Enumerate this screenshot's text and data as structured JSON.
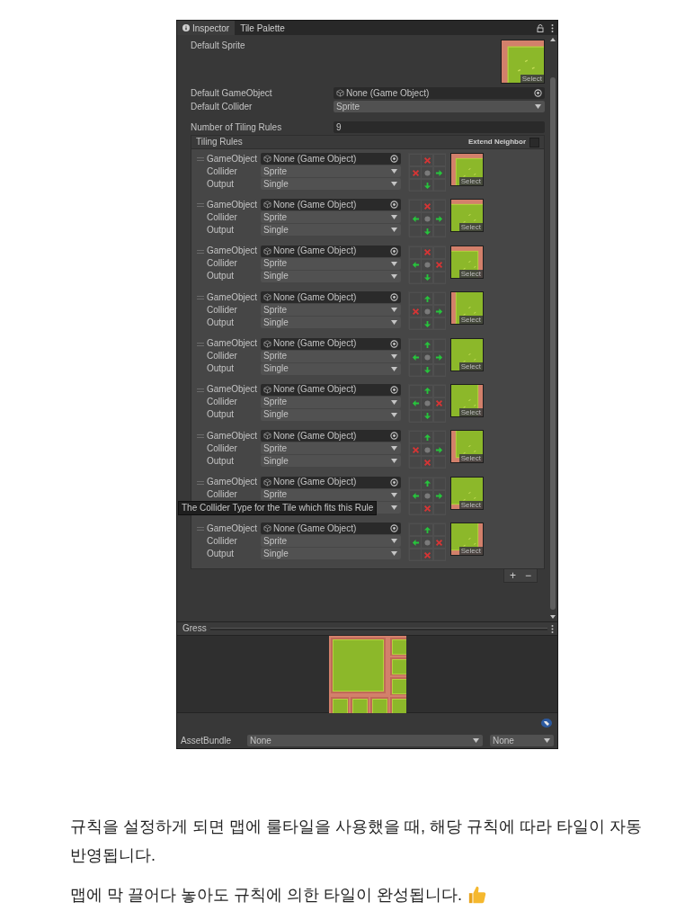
{
  "tabs": [
    {
      "label": "Inspector",
      "selected": true
    },
    {
      "label": "Tile Palette",
      "selected": false
    }
  ],
  "default_sprite": {
    "label": "Default Sprite",
    "select": "Select"
  },
  "fields": [
    {
      "label": "Default GameObject",
      "value": "None (Game Object)",
      "kind": "object"
    },
    {
      "label": "Default Collider",
      "value": "Sprite",
      "kind": "dropdown"
    },
    {
      "label": "Number of Tiling Rules",
      "value": "9",
      "kind": "number"
    }
  ],
  "tiling_rules": {
    "title": "Tiling Rules",
    "extend_neighbor": {
      "label": "Extend Neighbor",
      "checked": false
    },
    "add": "+",
    "remove": "−",
    "rules": [
      {
        "gameobject_label": "GameObject",
        "gameobject": "None (Game Object)",
        "collider_label": "Collider",
        "collider": "Sprite",
        "output_label": "Output",
        "output": "Single",
        "neighbors": {
          "top": {
            "kind": "not"
          },
          "left": {
            "kind": "not"
          },
          "right": {
            "kind": "this"
          },
          "bottom": {
            "kind": "this"
          }
        },
        "select": "Select"
      },
      {
        "gameobject_label": "GameObject",
        "gameobject": "None (Game Object)",
        "collider_label": "Collider",
        "collider": "Sprite",
        "output_label": "Output",
        "output": "Single",
        "neighbors": {
          "top": {
            "kind": "not"
          },
          "left": {
            "kind": "this"
          },
          "right": {
            "kind": "this"
          },
          "bottom": {
            "kind": "this"
          }
        },
        "select": "Select"
      },
      {
        "gameobject_label": "GameObject",
        "gameobject": "None (Game Object)",
        "collider_label": "Collider",
        "collider": "Sprite",
        "output_label": "Output",
        "output": "Single",
        "neighbors": {
          "top": {
            "kind": "not"
          },
          "left": {
            "kind": "this"
          },
          "right": {
            "kind": "not"
          },
          "bottom": {
            "kind": "this"
          }
        },
        "select": "Select"
      },
      {
        "gameobject_label": "GameObject",
        "gameobject": "None (Game Object)",
        "collider_label": "Collider",
        "collider": "Sprite",
        "output_label": "Output",
        "output": "Single",
        "neighbors": {
          "top": {
            "kind": "this"
          },
          "left": {
            "kind": "not"
          },
          "right": {
            "kind": "this"
          },
          "bottom": {
            "kind": "this"
          }
        },
        "select": "Select"
      },
      {
        "gameobject_label": "GameObject",
        "gameobject": "None (Game Object)",
        "collider_label": "Collider",
        "collider": "Sprite",
        "output_label": "Output",
        "output": "Single",
        "neighbors": {
          "top": {
            "kind": "this"
          },
          "left": {
            "kind": "this"
          },
          "right": {
            "kind": "this"
          },
          "bottom": {
            "kind": "this"
          }
        },
        "select": "Select"
      },
      {
        "gameobject_label": "GameObject",
        "gameobject": "None (Game Object)",
        "collider_label": "Collider",
        "collider": "Sprite",
        "output_label": "Output",
        "output": "Single",
        "neighbors": {
          "top": {
            "kind": "this"
          },
          "left": {
            "kind": "this"
          },
          "right": {
            "kind": "not"
          },
          "bottom": {
            "kind": "this"
          }
        },
        "select": "Select"
      },
      {
        "gameobject_label": "GameObject",
        "gameobject": "None (Game Object)",
        "collider_label": "Collider",
        "collider": "Sprite",
        "output_label": "Output",
        "output": "Single",
        "neighbors": {
          "top": {
            "kind": "this"
          },
          "left": {
            "kind": "not"
          },
          "right": {
            "kind": "this"
          },
          "bottom": {
            "kind": "not"
          }
        },
        "select": "Select"
      },
      {
        "gameobject_label": "GameObject",
        "gameobject": "None (Game Object)",
        "collider_label": "Collider",
        "collider": "Sprite",
        "neighbors": {
          "top": {
            "kind": "this"
          },
          "left": {
            "kind": "this"
          },
          "right": {
            "kind": "this"
          },
          "bottom": {
            "kind": "not"
          }
        },
        "select": "Select",
        "tooltip": "The Collider Type for the Tile which fits this Rule"
      },
      {
        "gameobject_label": "GameObject",
        "gameobject": "None (Game Object)",
        "collider_label": "Collider",
        "collider": "Sprite",
        "output_label": "Output",
        "output": "Single",
        "neighbors": {
          "top": {
            "kind": "this"
          },
          "left": {
            "kind": "this"
          },
          "right": {
            "kind": "not"
          },
          "bottom": {
            "kind": "not"
          }
        },
        "select": "Select"
      }
    ]
  },
  "preview": {
    "title": "Gress"
  },
  "asset_bundle": {
    "label": "AssetBundle",
    "values": [
      "None",
      "None"
    ]
  },
  "caption": {
    "paragraphs": [
      "규칙을 설정하게 되면 맵에 룰타일을 사용했을 때, 해당 규칙에 따라 타일이 자동 반영됩니다.",
      "맵에 막 끌어다 놓아도 규칙에 의한 타일이 완성됩니다."
    ]
  }
}
